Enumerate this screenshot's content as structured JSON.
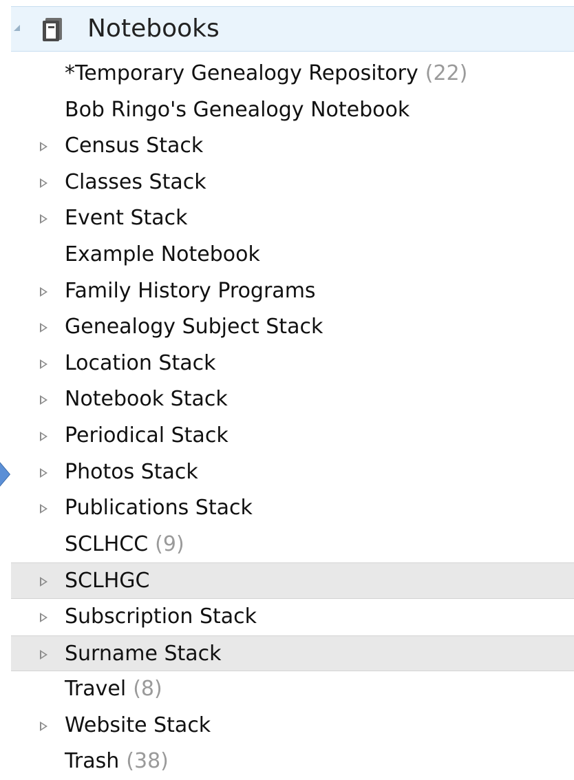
{
  "header": {
    "title": "Notebooks",
    "icon": "notebook-icon",
    "expanded": true
  },
  "items": [
    {
      "label": "*Temporary Genealogy Repository",
      "count": "(22)",
      "expandable": false
    },
    {
      "label": "Bob Ringo's Genealogy Notebook",
      "count": "",
      "expandable": false
    },
    {
      "label": "Census Stack",
      "count": "",
      "expandable": true
    },
    {
      "label": "Classes Stack",
      "count": "",
      "expandable": true
    },
    {
      "label": "Event Stack",
      "count": "",
      "expandable": true
    },
    {
      "label": "Example Notebook",
      "count": "",
      "expandable": false
    },
    {
      "label": "Family History Programs",
      "count": "",
      "expandable": true
    },
    {
      "label": "Genealogy Subject Stack",
      "count": "",
      "expandable": true
    },
    {
      "label": "Location Stack",
      "count": "",
      "expandable": true
    },
    {
      "label": "Notebook Stack",
      "count": "",
      "expandable": true
    },
    {
      "label": "Periodical Stack",
      "count": "",
      "expandable": true
    },
    {
      "label": "Photos Stack",
      "count": "",
      "expandable": true
    },
    {
      "label": "Publications Stack",
      "count": "",
      "expandable": true
    },
    {
      "label": "SCLHCC",
      "count": "(9)",
      "expandable": false
    },
    {
      "label": "SCLHGC",
      "count": "",
      "expandable": true,
      "highlighted": true
    },
    {
      "label": "Subscription Stack",
      "count": "",
      "expandable": true
    },
    {
      "label": "Surname Stack",
      "count": "",
      "expandable": true,
      "highlighted": true
    },
    {
      "label": "Travel",
      "count": "(8)",
      "expandable": false
    },
    {
      "label": "Website Stack",
      "count": "",
      "expandable": true
    },
    {
      "label": "Trash",
      "count": "(38)",
      "expandable": false
    }
  ],
  "colors": {
    "header_bg": "#eaf4fc",
    "highlight_bg": "#e8e8e8",
    "count_text": "#9a9a9a",
    "pointer": "#5b8fd6"
  }
}
